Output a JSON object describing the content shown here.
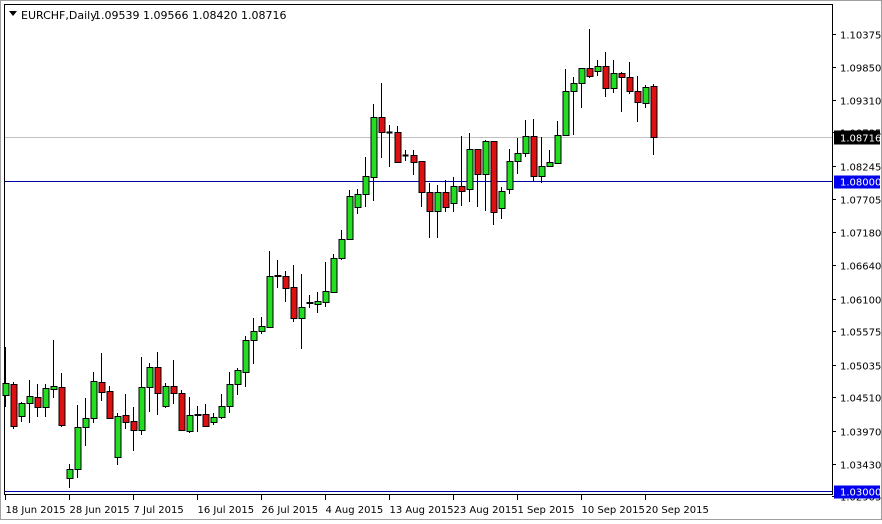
{
  "header": {
    "symbol_label": "EURCHF,Daily",
    "ohlc_label": "1.09539 1.09566 1.08420 1.08716",
    "menu_icon": "triangle-down-icon"
  },
  "colors": {
    "bull": "#22dd22",
    "bear": "#dd1111",
    "level_line": "#0000aa",
    "level_label_bg": "#0000ee",
    "price_line": "#c0c0c0",
    "price_label_bg": "#000000"
  },
  "chart_data": {
    "type": "candlestick",
    "title": "EURCHF,Daily",
    "xlabel": "",
    "ylabel": "",
    "ylim": [
      1.02905,
      1.10375
    ],
    "grid": false,
    "y_ticks": [
      "1.10375",
      "1.09850",
      "1.09310",
      "1.08785",
      "1.08245",
      "1.07705",
      "1.07180",
      "1.06640",
      "1.06100",
      "1.05575",
      "1.05035",
      "1.04510",
      "1.03970",
      "1.03430",
      "1.02905"
    ],
    "x_labels": [
      {
        "index": 0,
        "label": "18 Jun 2015"
      },
      {
        "index": 8,
        "label": "28 Jun 2015"
      },
      {
        "index": 16,
        "label": "7 Jul 2015"
      },
      {
        "index": 24,
        "label": "16 Jul 2015"
      },
      {
        "index": 32,
        "label": "26 Jul 2015"
      },
      {
        "index": 40,
        "label": "4 Aug 2015"
      },
      {
        "index": 48,
        "label": "13 Aug 2015"
      },
      {
        "index": 56,
        "label": "23 Aug 2015"
      },
      {
        "index": 64,
        "label": "1 Sep 2015"
      },
      {
        "index": 72,
        "label": "10 Sep 2015"
      },
      {
        "index": 80,
        "label": "20 Sep 2015"
      }
    ],
    "current_price": {
      "value": 1.08716,
      "label": "1.08716"
    },
    "levels": [
      {
        "value": 1.08,
        "label": "1.08000"
      },
      {
        "value": 1.03,
        "label": "1.03000"
      }
    ],
    "ohlc": [
      [
        1.04545,
        1.0532,
        1.04351,
        1.04739
      ],
      [
        1.04722,
        1.04755,
        1.03996,
        1.04044
      ],
      [
        1.04206,
        1.04432,
        1.04109,
        1.04416
      ],
      [
        1.04416,
        1.04787,
        1.04093,
        1.04529
      ],
      [
        1.04512,
        1.04722,
        1.04189,
        1.04351
      ],
      [
        1.04351,
        1.04722,
        1.04189,
        1.04658
      ],
      [
        1.04642,
        1.05433,
        1.04496,
        1.0469
      ],
      [
        1.04674,
        1.049,
        1.04028,
        1.0406
      ],
      [
        1.03204,
        1.0343,
        1.03043,
        1.0335
      ],
      [
        1.0335,
        1.04383,
        1.03204,
        1.04028
      ],
      [
        1.04028,
        1.04496,
        1.03721,
        1.04173
      ],
      [
        1.04173,
        1.04916,
        1.04093,
        1.04771
      ],
      [
        1.04755,
        1.05223,
        1.04448,
        1.04593
      ],
      [
        1.04609,
        1.0469,
        1.04173,
        1.04173
      ],
      [
        1.03543,
        1.04254,
        1.03414,
        1.04206
      ],
      [
        1.04222,
        1.04561,
        1.03996,
        1.04109
      ],
      [
        1.04125,
        1.04351,
        1.0364,
        1.03979
      ],
      [
        1.03979,
        1.05158,
        1.03899,
        1.04674
      ],
      [
        1.04674,
        1.05062,
        1.0427,
        1.04997
      ],
      [
        1.04997,
        1.05239,
        1.04222,
        1.04577
      ],
      [
        1.04367,
        1.04739,
        1.04335,
        1.0469
      ],
      [
        1.0469,
        1.0511,
        1.04399,
        1.04577
      ],
      [
        1.04577,
        1.04625,
        1.03963,
        1.03979
      ],
      [
        1.03963,
        1.04512,
        1.03931,
        1.04222
      ],
      [
        1.04222,
        1.04367,
        1.03947,
        1.0423
      ],
      [
        1.04238,
        1.04399,
        1.04044,
        1.04044
      ],
      [
        1.04109,
        1.04254,
        1.0406,
        1.04189
      ],
      [
        1.04189,
        1.04561,
        1.04157,
        1.04367
      ],
      [
        1.04367,
        1.04916,
        1.04254,
        1.04722
      ],
      [
        1.04722,
        1.04981,
        1.04545,
        1.04948
      ],
      [
        1.04916,
        1.05498,
        1.04674,
        1.05433
      ],
      [
        1.05433,
        1.05788,
        1.05045,
        1.05578
      ],
      [
        1.05578,
        1.05804,
        1.0553,
        1.05659
      ],
      [
        1.05643,
        1.0687,
        1.05627,
        1.06467
      ],
      [
        1.06467,
        1.06725,
        1.06273,
        1.06475
      ],
      [
        1.06467,
        1.06547,
        1.06047,
        1.06273
      ],
      [
        1.06289,
        1.06644,
        1.05724,
        1.05788
      ],
      [
        1.05788,
        1.06499,
        1.05288,
        1.05966
      ],
      [
        1.06031,
        1.0616,
        1.0595,
        1.0604
      ],
      [
        1.06014,
        1.06208,
        1.05869,
        1.06063
      ],
      [
        1.06047,
        1.06693,
        1.05966,
        1.06224
      ],
      [
        1.06208,
        1.06822,
        1.06192,
        1.06757
      ],
      [
        1.06757,
        1.07209,
        1.06725,
        1.07064
      ],
      [
        1.07064,
        1.07855,
        1.07048,
        1.07759
      ],
      [
        1.07581,
        1.07872,
        1.07468,
        1.07791
      ],
      [
        1.07791,
        1.08388,
        1.07581,
        1.08082
      ],
      [
        1.08065,
        1.09244,
        1.07678,
        1.09034
      ],
      [
        1.09034,
        1.09584,
        1.08372,
        1.08792
      ],
      [
        1.08792,
        1.08905,
        1.08227,
        1.08785
      ],
      [
        1.08792,
        1.08889,
        1.08308,
        1.08308
      ],
      [
        1.08421,
        1.08501,
        1.08324,
        1.08415
      ],
      [
        1.08421,
        1.08501,
        1.08098,
        1.08308
      ],
      [
        1.08324,
        1.08324,
        1.07581,
        1.07823
      ],
      [
        1.07823,
        1.07969,
        1.0708,
        1.07516
      ],
      [
        1.07516,
        1.07936,
        1.0708,
        1.07823
      ],
      [
        1.07823,
        1.08017,
        1.075,
        1.07581
      ],
      [
        1.07646,
        1.08065,
        1.075,
        1.0792
      ],
      [
        1.0792,
        1.08728,
        1.07597,
        1.07839
      ],
      [
        1.07872,
        1.08776,
        1.07662,
        1.08518
      ],
      [
        1.08518,
        1.08518,
        1.07581,
        1.08114
      ],
      [
        1.08114,
        1.08663,
        1.07516,
        1.08647
      ],
      [
        1.08647,
        1.08647,
        1.0729,
        1.075
      ],
      [
        1.07565,
        1.07904,
        1.07387,
        1.07839
      ],
      [
        1.07872,
        1.08518,
        1.07791,
        1.08324
      ],
      [
        1.08324,
        1.08695,
        1.08114,
        1.08453
      ],
      [
        1.08453,
        1.08986,
        1.08388,
        1.08728
      ],
      [
        1.08728,
        1.09002,
        1.08001,
        1.08082
      ],
      [
        1.08082,
        1.08711,
        1.07969,
        1.08243
      ],
      [
        1.08243,
        1.08501,
        1.08227,
        1.08308
      ],
      [
        1.08292,
        1.0897,
        1.08292,
        1.08744
      ],
      [
        1.08744,
        1.0981,
        1.08744,
        1.09454
      ],
      [
        1.09454,
        1.0968,
        1.08744,
        1.09584
      ],
      [
        1.09584,
        1.09826,
        1.0918,
        1.09826
      ],
      [
        1.09826,
        1.10456,
        1.09664,
        1.09697
      ],
      [
        1.09777,
        1.09955,
        1.09697,
        1.09858
      ],
      [
        1.09858,
        1.10084,
        1.09357,
        1.09503
      ],
      [
        1.09503,
        1.09955,
        1.09422,
        1.09745
      ],
      [
        1.09745,
        1.09761,
        1.09115,
        1.0968
      ],
      [
        1.0968,
        1.09923,
        1.09406,
        1.09454
      ],
      [
        1.09454,
        1.09697,
        1.08954,
        1.09277
      ],
      [
        1.09261,
        1.09551,
        1.0918,
        1.09519
      ],
      [
        1.09539,
        1.09566,
        1.0842,
        1.08716
      ]
    ]
  }
}
